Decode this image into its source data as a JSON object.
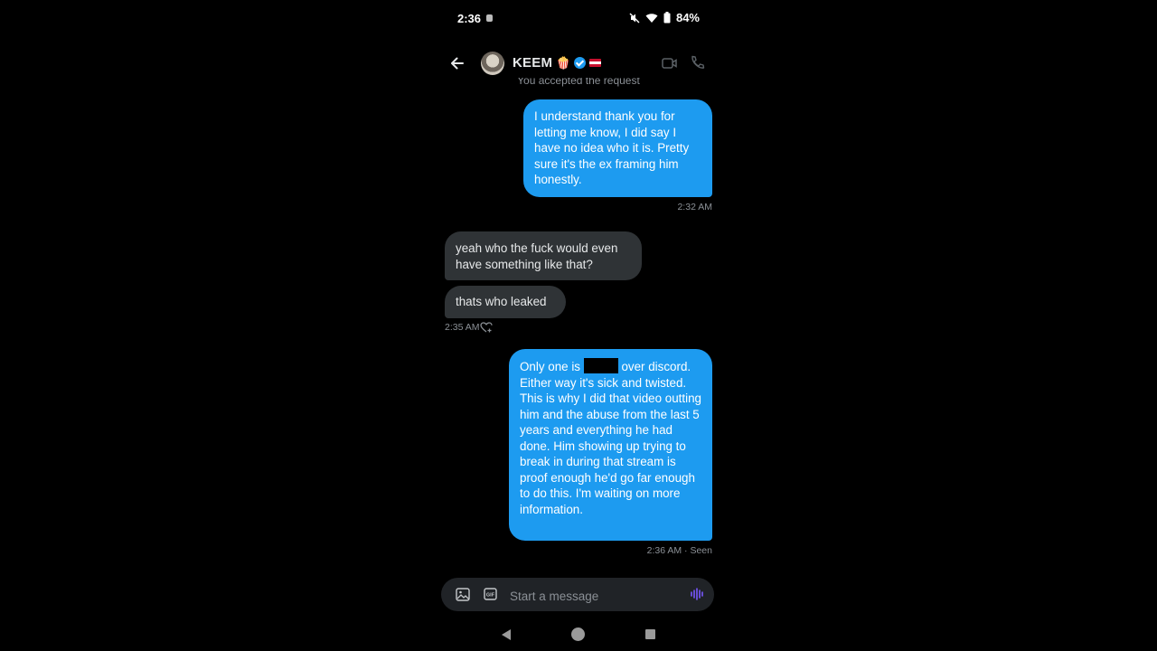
{
  "status_bar": {
    "time": "2:36",
    "battery": "84%"
  },
  "header": {
    "name": "KEEM",
    "name_emoji": "🍿"
  },
  "notice": "You accepted the request",
  "messages": [
    {
      "id": "m1",
      "direction": "outgoing",
      "text": "I understand thank you for letting me know, I did say I have no idea who it is. Pretty sure it's the ex framing him honestly.",
      "meta": "2:32 AM"
    },
    {
      "id": "m2",
      "direction": "incoming",
      "text": "yeah who the fuck would even have something like that?"
    },
    {
      "id": "m3",
      "direction": "incoming",
      "text": "thats who leaked",
      "meta": "2:35 AM"
    },
    {
      "id": "m4",
      "direction": "outgoing",
      "text_before_redaction": "Only one is",
      "text_after_redaction": "over discord. Either way it's sick and twisted. This is why I did that video outting him and the abuse from the last 5 years and everything he had done. Him showing up trying to break in during that stream is proof enough he'd go far enough to do this. I'm waiting on more information.",
      "meta": "2:36 AM · Seen"
    }
  ],
  "composer": {
    "placeholder": "Start a message"
  },
  "colors": {
    "background": "#000000",
    "outgoing_bubble": "#1d9bf0",
    "incoming_bubble": "#2f3336",
    "meta_text": "#8b9096",
    "voice_accent": "#7856ff"
  }
}
